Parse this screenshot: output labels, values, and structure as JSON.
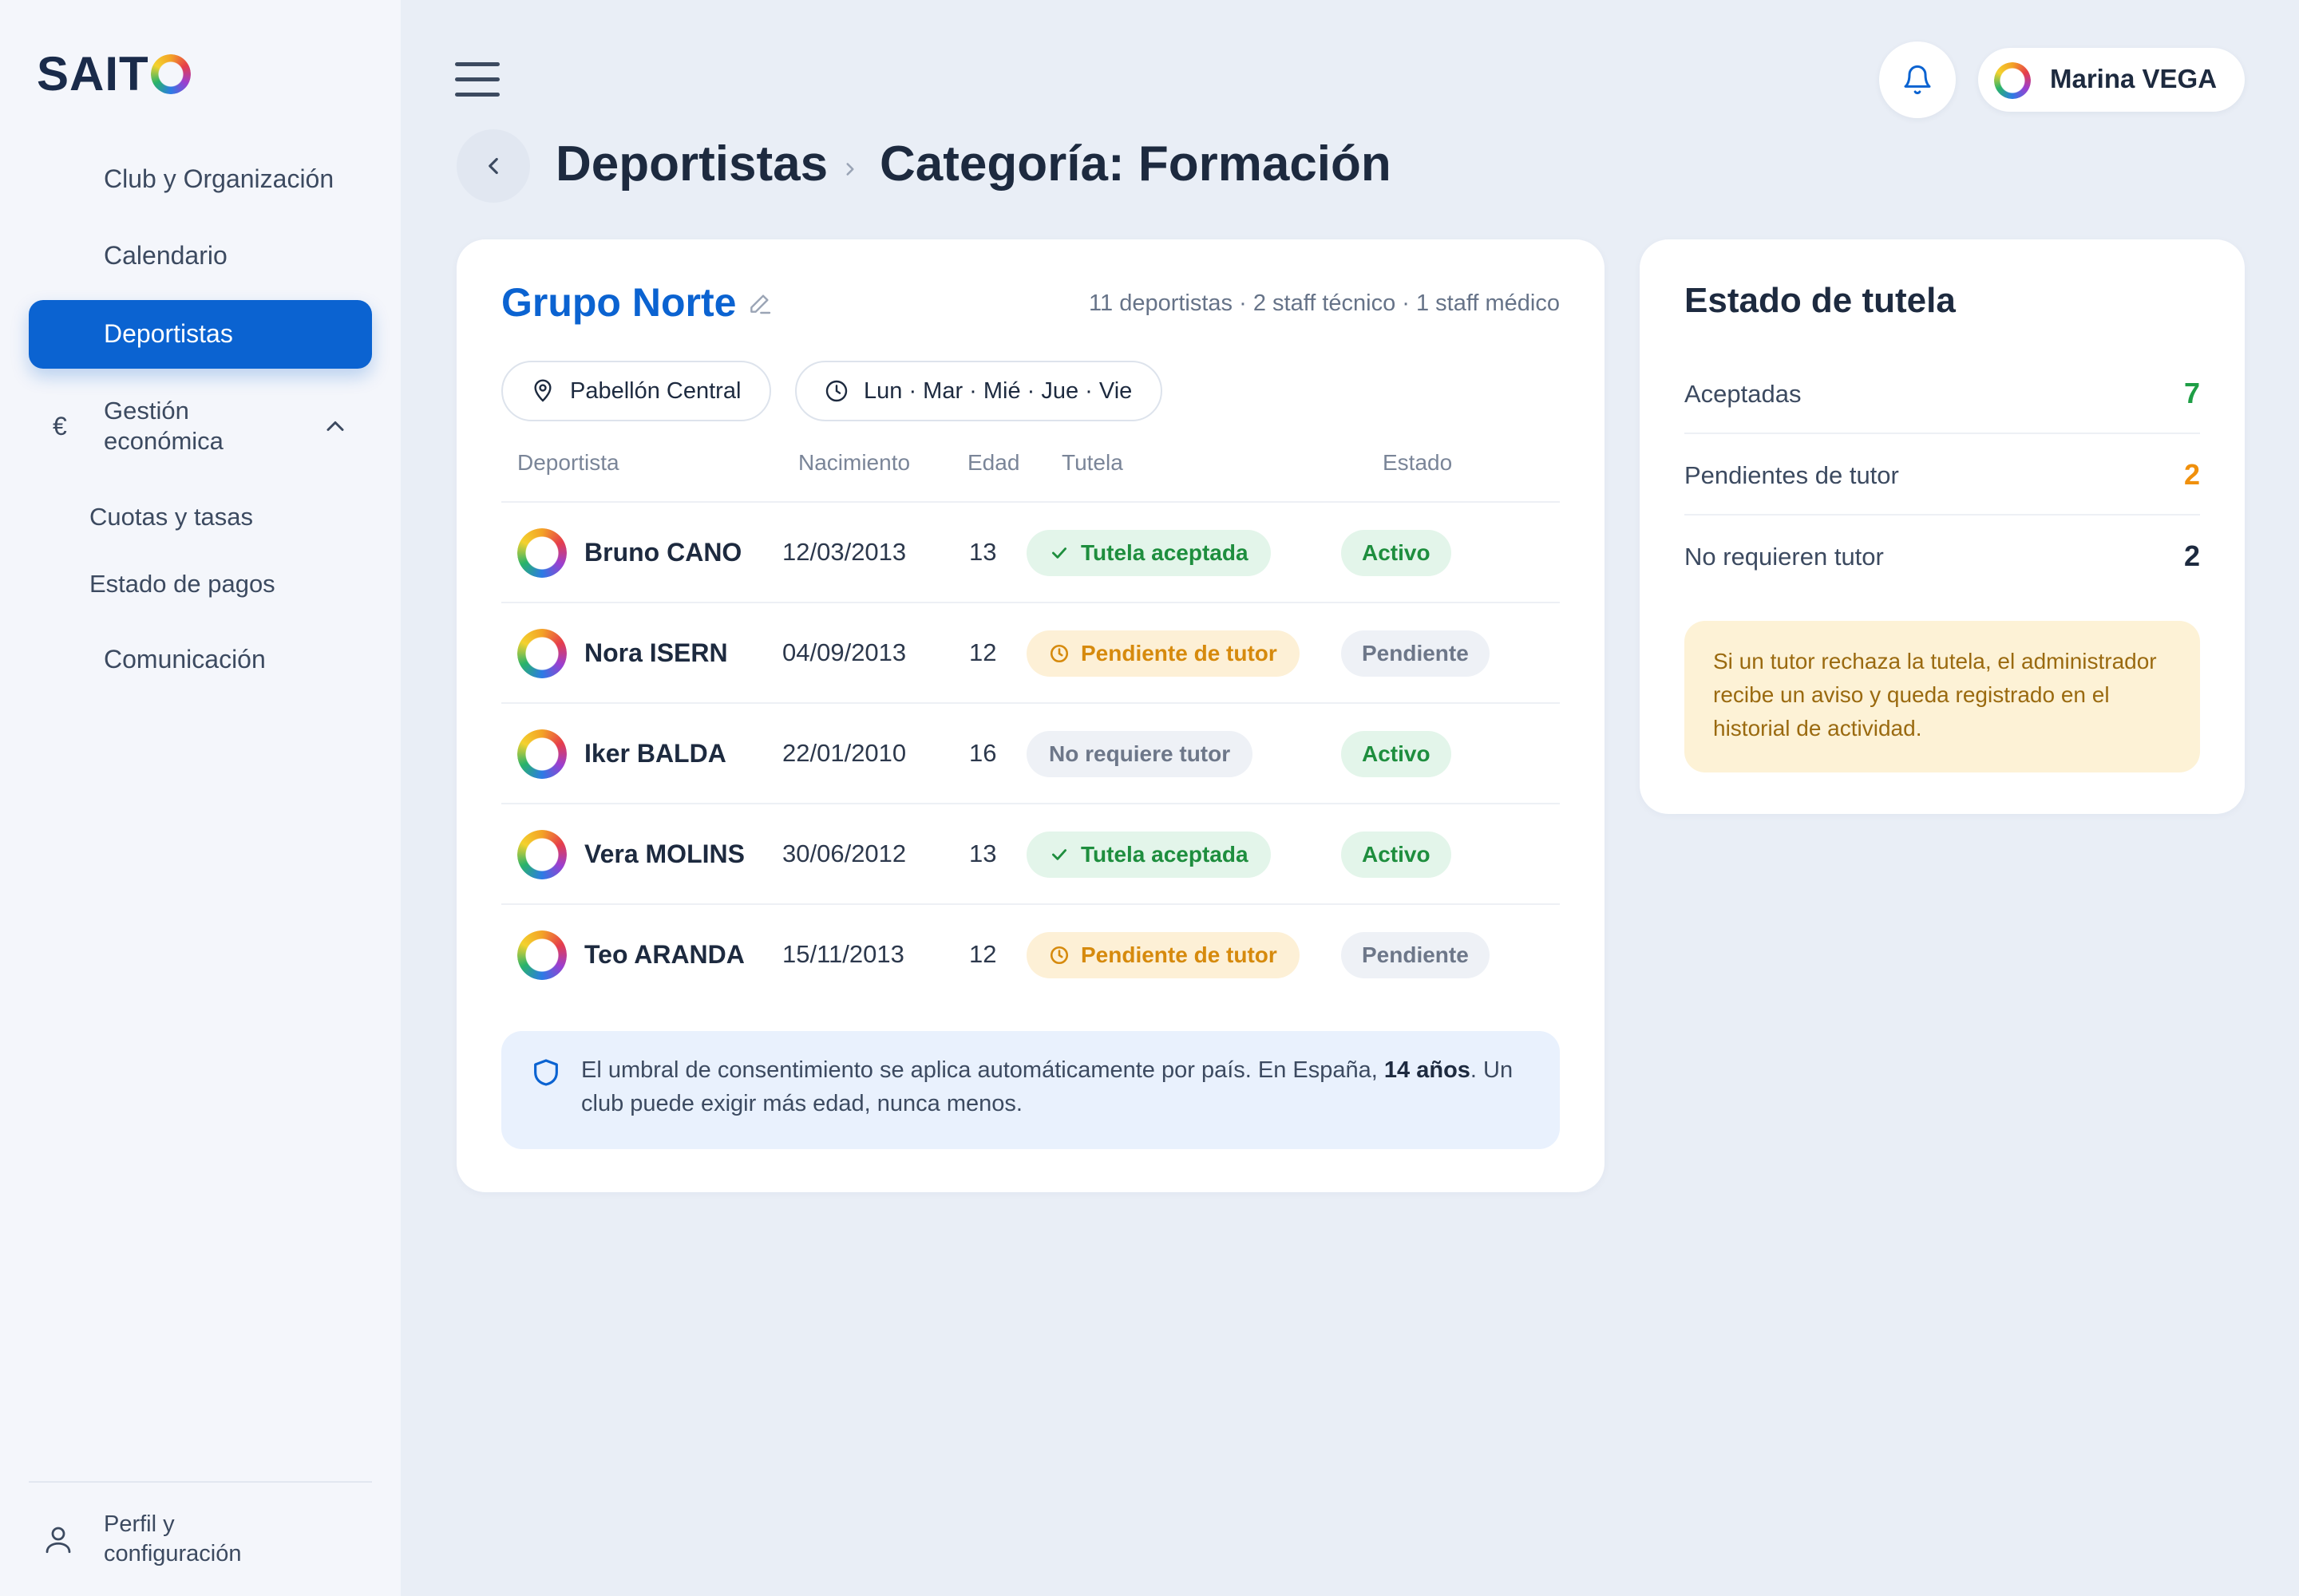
{
  "brand": {
    "logo_text": "SAIT",
    "logo_ring_icon": "logo-o-ring"
  },
  "sidebar": {
    "items": [
      {
        "label": "Club y Organización"
      },
      {
        "label": "Calendario"
      },
      {
        "label": "Deportistas",
        "active": true
      },
      {
        "label": "Gestión económica",
        "icon": "euro-icon",
        "expanded": true,
        "children": [
          {
            "label": "Cuotas y tasas"
          },
          {
            "label": "Estado de pagos"
          }
        ]
      },
      {
        "label": "Comunicación"
      }
    ],
    "profile": {
      "label": "Perfil y configuración",
      "icon": "user-icon"
    }
  },
  "topbar": {
    "menu_icon": "hamburger-icon",
    "notifications_icon": "bell-icon",
    "user": {
      "name": "Marina VEGA"
    }
  },
  "breadcrumb": {
    "items": [
      "Deportistas",
      "Categoría: Formación"
    ]
  },
  "group": {
    "title": "Grupo Norte",
    "meta": "11 deportistas · 2 staff técnico · 1 staff médico",
    "location": "Pabellón Central",
    "schedule": "Lun · Mar · Mié · Jue · Vie"
  },
  "table": {
    "headers": [
      "Deportista",
      "Nacimiento",
      "Edad",
      "Tutela",
      "Estado"
    ],
    "rows": [
      {
        "name": "Bruno CANO",
        "dob": "12/03/2013",
        "age": "13",
        "tutela": "Tutela aceptada",
        "tutela_type": "ok",
        "estado": "Activo",
        "estado_type": "active"
      },
      {
        "name": "Nora ISERN",
        "dob": "04/09/2013",
        "age": "12",
        "tutela": "Pendiente de tutor",
        "tutela_type": "pend",
        "estado": "Pendiente",
        "estado_type": "waiting"
      },
      {
        "name": "Iker BALDA",
        "dob": "22/01/2010",
        "age": "16",
        "tutela": "No requiere tutor",
        "tutela_type": "none",
        "estado": "Activo",
        "estado_type": "active"
      },
      {
        "name": "Vera MOLINS",
        "dob": "30/06/2012",
        "age": "13",
        "tutela": "Tutela aceptada",
        "tutela_type": "ok",
        "estado": "Activo",
        "estado_type": "active"
      },
      {
        "name": "Teo ARANDA",
        "dob": "15/11/2013",
        "age": "12",
        "tutela": "Pendiente de tutor",
        "tutela_type": "pend",
        "estado": "Pendiente",
        "estado_type": "waiting"
      }
    ]
  },
  "consent_note": {
    "text_before": "El umbral de consentimiento se aplica automáticamente por país. En España, ",
    "highlight": "14 años",
    "text_after": ". Un club puede exigir más edad, nunca menos."
  },
  "tutela_status": {
    "title": "Estado de tutela",
    "stats": [
      {
        "label": "Aceptadas",
        "value": "7",
        "color": "#1e9e45"
      },
      {
        "label": "Pendientes de tutor",
        "value": "2",
        "color": "#f0900c"
      },
      {
        "label": "No requieren tutor",
        "value": "2",
        "color": "#1d2a3f"
      }
    ],
    "warning": "Si un tutor rechaza la tutela, el administrador recibe un aviso y queda registrado en el historial de actividad."
  },
  "colors": {
    "accent": "#0b63d1",
    "success": "#1e8e3e",
    "warning": "#d68a0d",
    "background": "#e9eef6"
  }
}
